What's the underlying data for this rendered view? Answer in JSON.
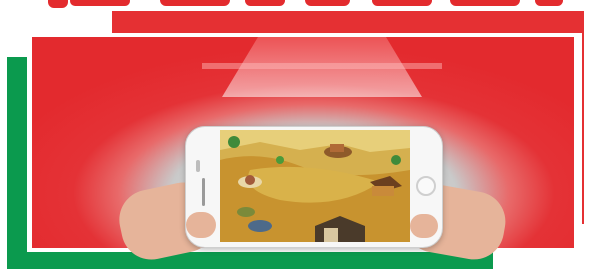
{
  "image": {
    "subject": "smartphone-game-promo",
    "colors": {
      "red": "#e53033",
      "green": "#0b9a4e",
      "white": "#ffffff"
    },
    "icons": [
      "home-button-icon",
      "camera-icon",
      "speaker-icon"
    ]
  }
}
